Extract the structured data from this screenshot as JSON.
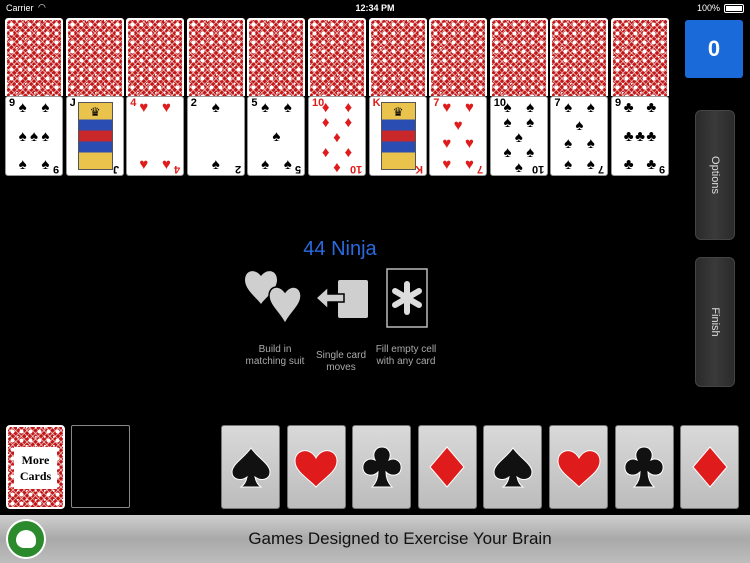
{
  "status_bar": {
    "carrier": "Carrier",
    "time": "12:34 PM",
    "battery": "100%"
  },
  "score": "0",
  "side_buttons": {
    "options": "Options",
    "finish": "Finish"
  },
  "columns": [
    {
      "rank": "9",
      "suit": "♠",
      "color": "black",
      "pips": 9
    },
    {
      "rank": "J",
      "suit": "♠",
      "color": "black",
      "court": true
    },
    {
      "rank": "4",
      "suit": "♥",
      "color": "red",
      "pips": 4
    },
    {
      "rank": "2",
      "suit": "♠",
      "color": "black",
      "pips": 2
    },
    {
      "rank": "5",
      "suit": "♠",
      "color": "black",
      "pips": 5
    },
    {
      "rank": "10",
      "suit": "♦",
      "color": "red",
      "pips": 10
    },
    {
      "rank": "K",
      "suit": "♦",
      "color": "red",
      "court": true
    },
    {
      "rank": "7",
      "suit": "♥",
      "color": "red",
      "pips": 7
    },
    {
      "rank": "10",
      "suit": "♠",
      "color": "black",
      "pips": 10
    },
    {
      "rank": "7",
      "suit": "♠",
      "color": "black",
      "pips": 7
    },
    {
      "rank": "9",
      "suit": "♣",
      "color": "black",
      "pips": 9
    }
  ],
  "game_info": {
    "title": "44 Ninja",
    "rules": [
      {
        "icon": "hearts-icon",
        "label": "Build in matching suit"
      },
      {
        "icon": "single-move-icon",
        "label": "Single card moves"
      },
      {
        "icon": "asterisk-icon",
        "label": "Fill empty cell with any card"
      }
    ]
  },
  "more_cards": {
    "line1": "More",
    "line2": "Cards"
  },
  "foundations": [
    {
      "suit": "spade",
      "color": "#111111"
    },
    {
      "suit": "heart",
      "color": "#e01b1b"
    },
    {
      "suit": "club",
      "color": "#111111"
    },
    {
      "suit": "diamond",
      "color": "#e01b1b"
    },
    {
      "suit": "spade",
      "color": "#111111"
    },
    {
      "suit": "heart",
      "color": "#e01b1b"
    },
    {
      "suit": "club",
      "color": "#111111"
    },
    {
      "suit": "diamond",
      "color": "#e01b1b"
    }
  ],
  "banner": {
    "tagline": "Games Designed to Exercise Your Brain"
  },
  "colors": {
    "accent": "#1a6ad9",
    "title": "#2a6ae0",
    "card_back": "#c01818"
  }
}
